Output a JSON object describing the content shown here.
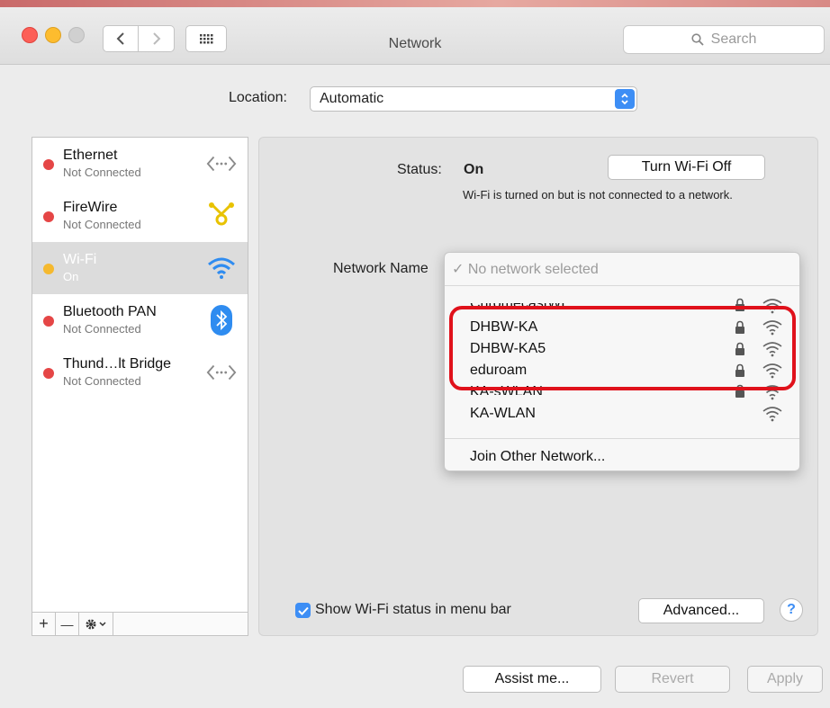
{
  "window": {
    "title": "Network",
    "search_placeholder": "Search"
  },
  "location": {
    "label": "Location:",
    "value": "Automatic"
  },
  "services": [
    {
      "name": "Ethernet",
      "status": "Not Connected",
      "dot_color": "#e54646",
      "icon": "ethernet-arrows-icon"
    },
    {
      "name": "FireWire",
      "status": "Not Connected",
      "dot_color": "#e54646",
      "icon": "firewire-icon"
    },
    {
      "name": "Wi-Fi",
      "status": "On",
      "dot_color": "#f5b92f",
      "icon": "wifi-icon",
      "selected": true
    },
    {
      "name": "Bluetooth PAN",
      "status": "Not Connected",
      "dot_color": "#e54646",
      "icon": "bluetooth-icon"
    },
    {
      "name": "Thund…lt Bridge",
      "status": "Not Connected",
      "dot_color": "#e54646",
      "icon": "thunderbolt-bridge-icon"
    }
  ],
  "sidebar_footer": {
    "add": "+",
    "remove": "—"
  },
  "status": {
    "label": "Status:",
    "value": "On",
    "toggle_button": "Turn Wi-Fi Off",
    "description": "Wi-Fi is turned on but is not connected to a network."
  },
  "network_name": {
    "label": "Network Name",
    "current": "✓ No network selected",
    "networks": [
      {
        "name": "ChromecastWL",
        "locked": true
      },
      {
        "name": "DHBW-KA",
        "locked": true
      },
      {
        "name": "DHBW-KA5",
        "locked": true
      },
      {
        "name": "eduroam",
        "locked": true
      },
      {
        "name": "KA-sWLAN",
        "locked": true
      },
      {
        "name": "KA-WLAN",
        "locked": false
      }
    ],
    "join_other": "Join Other Network..."
  },
  "show_status_label": "Show Wi-Fi status in menu bar",
  "advanced_button": "Advanced...",
  "help_button": "?",
  "footer_buttons": {
    "assist": "Assist me...",
    "revert": "Revert",
    "apply": "Apply"
  },
  "colors": {
    "accent_blue": "#3d8ef5",
    "highlight_red": "#e0111b"
  }
}
